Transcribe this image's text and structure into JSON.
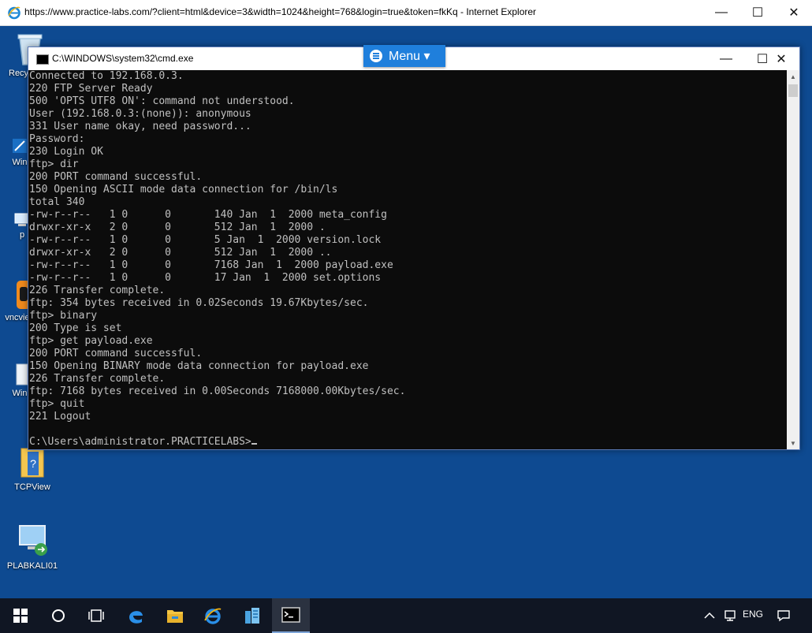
{
  "browser": {
    "title": "https://www.practice-labs.com/?client=html&device=3&width=1024&height=768&login=true&token=fkKq - Internet Explorer",
    "controls": {
      "minimize": "—",
      "maximize": "☐",
      "close": "✕"
    }
  },
  "desktop_icons": [
    {
      "name": "recycle-bin",
      "label": "Recy"
    },
    {
      "name": "windows",
      "label": "Win"
    },
    {
      "name": "pc",
      "label": "p"
    },
    {
      "name": "vncviewer",
      "label": "vncvie"
    },
    {
      "name": "windows-2",
      "label": "Win"
    },
    {
      "name": "tcpview",
      "label": "TCPView"
    },
    {
      "name": "plabkali01",
      "label": "PLABKALI01"
    }
  ],
  "cmd": {
    "title": "C:\\WINDOWS\\system32\\cmd.exe",
    "controls": {
      "minimize": "—",
      "maximize": "☐",
      "close": "✕"
    },
    "lines": [
      "Connected to 192.168.0.3.",
      "220 FTP Server Ready",
      "500 'OPTS UTF8 ON': command not understood.",
      "User (192.168.0.3:(none)): anonymous",
      "331 User name okay, need password...",
      "Password:",
      "230 Login OK",
      "ftp> dir",
      "200 PORT command successful.",
      "150 Opening ASCII mode data connection for /bin/ls",
      "total 340",
      "-rw-r--r--   1 0      0       140 Jan  1  2000 meta_config",
      "drwxr-xr-x   2 0      0       512 Jan  1  2000 .",
      "-rw-r--r--   1 0      0       5 Jan  1  2000 version.lock",
      "drwxr-xr-x   2 0      0       512 Jan  1  2000 ..",
      "-rw-r--r--   1 0      0       7168 Jan  1  2000 payload.exe",
      "-rw-r--r--   1 0      0       17 Jan  1  2000 set.options",
      "226 Transfer complete.",
      "ftp: 354 bytes received in 0.02Seconds 19.67Kbytes/sec.",
      "ftp> binary",
      "200 Type is set",
      "ftp> get payload.exe",
      "200 PORT command successful.",
      "150 Opening BINARY mode data connection for payload.exe",
      "226 Transfer complete.",
      "ftp: 7168 bytes received in 0.00Seconds 7168000.00Kbytes/sec.",
      "ftp> quit",
      "221 Logout",
      "",
      "C:\\Users\\administrator.PRACTICELABS>"
    ]
  },
  "menu": {
    "label": "Menu ▾"
  },
  "taskbar": {
    "language": "ENG",
    "items": [
      "start",
      "search",
      "task-view",
      "edge",
      "file-explorer",
      "internet-explorer",
      "server-manager",
      "cmd"
    ]
  },
  "colors": {
    "desktop": "#0e4a91",
    "console_bg": "#0c0c0c",
    "console_fg": "#c0c0c0",
    "menu_accent": "#1f7fdc",
    "taskbar": "#101623"
  }
}
